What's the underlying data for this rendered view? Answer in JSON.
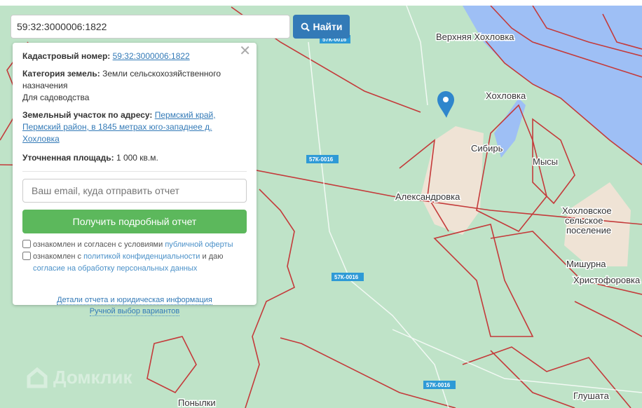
{
  "search": {
    "value": "59:32:3000006:1822",
    "button": "Найти"
  },
  "panel": {
    "cad_label": "Кадастровый номер:",
    "cad_value": "59:32:3000006:1822",
    "cat_label": "Категория земель:",
    "cat_value": "Земли сельскохозяйственного назначения",
    "use": "Для садоводства",
    "addr_label": "Земельный участок по адресу:",
    "addr_value": "Пермский край, Пермский район, в 1845 метрах юго-западнее д. Хохловка",
    "area_label": "Уточненная площадь:",
    "area_value": "1 000 кв.м.",
    "email_placeholder": "Ваш email, куда отправить отчет",
    "report_button": "Получить подробный отчет",
    "chk1_text": "ознакомлен и согласен с условиями ",
    "chk1_link": "публичной оферты",
    "chk2_text": "ознакомлен с ",
    "chk2_link": "политикой конфиденциальности",
    "chk2_mid": " и даю ",
    "chk2_link2": "согласие на обработку персональных данных",
    "link_details": "Детали отчета и юридическая информация",
    "link_manual": "Ручной выбор вариантов"
  },
  "map": {
    "places": [
      "Верхняя Хохловка",
      "Хохловка",
      "Сибирь",
      "Мысы",
      "Александровка",
      "Хохловское",
      "сельское",
      "поселение",
      "Мишурна",
      "Христофоровка",
      "Глушата",
      "Понылки"
    ],
    "road": "57К-0016",
    "logo": "Домклик"
  }
}
